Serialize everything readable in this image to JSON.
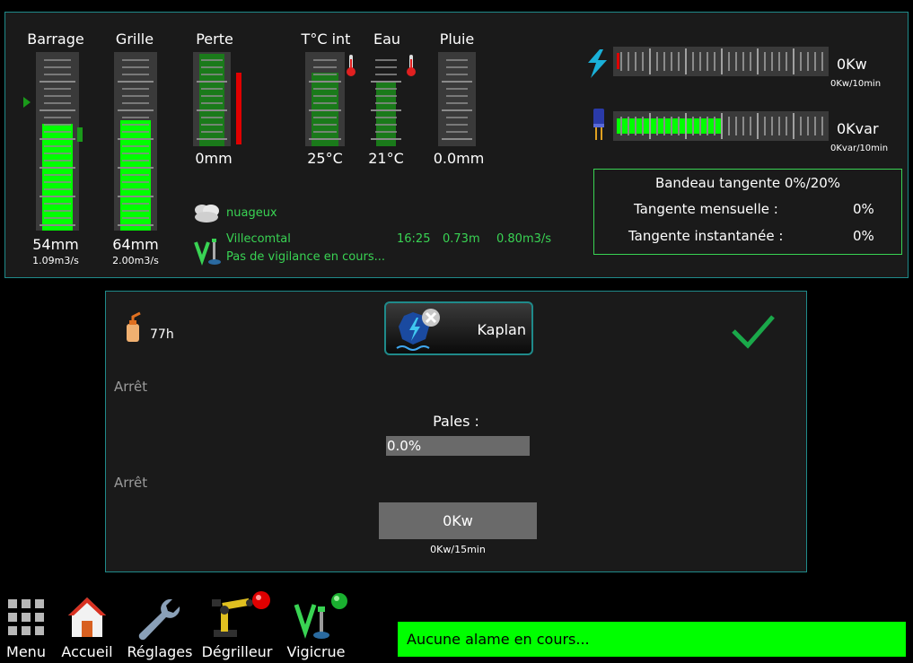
{
  "gauges": [
    {
      "key": "barrage",
      "label": "Barrage",
      "value": "54mm",
      "sub": "1.09m3/s",
      "level": 0.6
    },
    {
      "key": "grille",
      "label": "Grille",
      "value": "64mm",
      "sub": "2.00m3/s",
      "level": 0.62
    },
    {
      "key": "perte",
      "label": "Perte",
      "value": "0mm",
      "sub": "",
      "level": 0.98
    },
    {
      "key": "temp_int",
      "label": "T°C int",
      "value": "25°C",
      "sub": "",
      "level": 0.78
    },
    {
      "key": "eau",
      "label": "Eau",
      "value": "21°C",
      "sub": "",
      "level": 0.68
    },
    {
      "key": "pluie",
      "label": "Pluie",
      "value": "0.0mm",
      "sub": "",
      "level": 0.0
    }
  ],
  "weather": {
    "condition": "nuageux",
    "location": "Villecomtal",
    "time": "16:25",
    "level": "0.73m",
    "flow": "0.80m3/s",
    "vigilance": "Pas de vigilance en cours..."
  },
  "power": {
    "active": {
      "value": "0Kw",
      "sub": "0Kw/10min",
      "level": 0.0
    },
    "reactive": {
      "value": "0Kvar",
      "sub": "0Kvar/10min",
      "level": 0.5
    }
  },
  "tangent": {
    "title": "Bandeau tangente 0%/20%",
    "rows": [
      {
        "label": "Tangente mensuelle :",
        "value": "0%"
      },
      {
        "label": "Tangente instantanée :",
        "value": "0%"
      }
    ]
  },
  "turbine": {
    "hours": "77h",
    "name": "Kaplan",
    "state1": "Arrêt",
    "state2": "Arrêt",
    "pales_label": "Pales :",
    "pales_value": "0.0%",
    "pales_level": 0.0,
    "power_value": "0Kw",
    "power_sub": "0Kw/15min"
  },
  "nav": [
    {
      "key": "menu",
      "label": "Menu",
      "icon": "grid-icon"
    },
    {
      "key": "accueil",
      "label": "Accueil",
      "icon": "home-icon"
    },
    {
      "key": "reglages",
      "label": "Réglages",
      "icon": "wrench-icon"
    },
    {
      "key": "degrilleur",
      "label": "Dégrilleur",
      "icon": "robot-arm-icon"
    },
    {
      "key": "vigicrue",
      "label": "Vigicrue",
      "icon": "vigicrue-icon"
    }
  ],
  "alarm": {
    "text": "Aucune alame en cours..."
  },
  "colors": {
    "accent": "#1f8a8a",
    "level_green": "#00ff00",
    "dark_green": "#1a7a1a",
    "alarm_red": "#e00000",
    "ok_green": "#39d353"
  }
}
